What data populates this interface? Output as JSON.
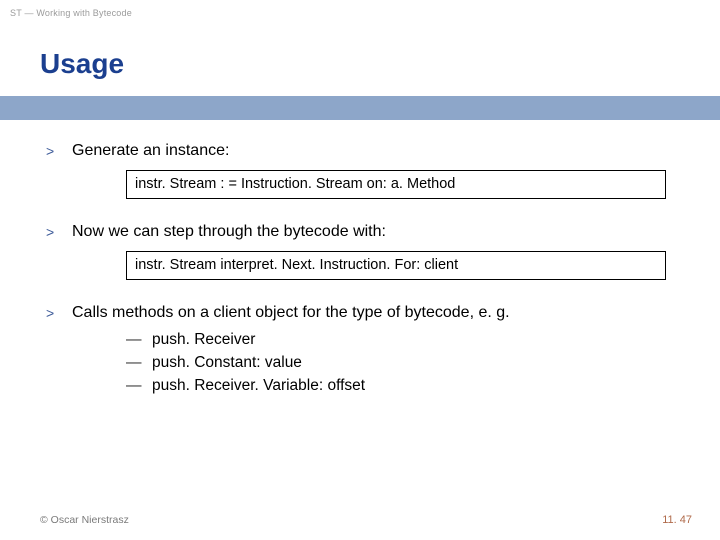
{
  "header": {
    "breadcrumb": "ST — Working with Bytecode"
  },
  "title": "Usage",
  "bullets": [
    {
      "marker": ">",
      "text": "Generate an instance:",
      "code": "instr. Stream : = Instruction. Stream on: a. Method"
    },
    {
      "marker": ">",
      "text": "Now we can step through the bytecode with:",
      "code": "instr. Stream interpret. Next. Instruction. For: client"
    },
    {
      "marker": ">",
      "text": "Calls methods on a client object for the type of bytecode, e. g.",
      "subs": [
        "push. Receiver",
        "push. Constant: value",
        "push. Receiver. Variable: offset"
      ]
    }
  ],
  "footer": {
    "copyright": "© Oscar Nierstrasz",
    "page": "11. 47"
  }
}
